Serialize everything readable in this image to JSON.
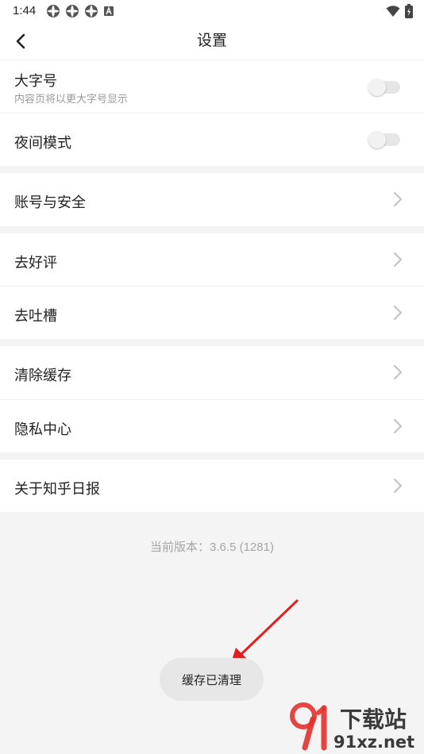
{
  "status_bar": {
    "time": "1:44",
    "left_icons": [
      "app-notification-icon",
      "app-notification-icon",
      "app-notification-icon",
      "font-a-icon"
    ],
    "right_icons": [
      "wifi-icon",
      "battery-icon"
    ]
  },
  "header": {
    "title": "设置",
    "back_icon": "back-arrow-icon"
  },
  "settings": {
    "large_font": {
      "label": "大字号",
      "subtitle": "内容页将以更大字号显示",
      "enabled": false
    },
    "night_mode": {
      "label": "夜间模式",
      "enabled": false
    },
    "account": {
      "label": "账号与安全"
    },
    "rate": {
      "label": "去好评"
    },
    "feedback": {
      "label": "去吐槽"
    },
    "clear_cache": {
      "label": "清除缓存"
    },
    "privacy": {
      "label": "隐私中心"
    },
    "about": {
      "label": "关于知乎日报"
    }
  },
  "version_text": "当前版本：3.6.5 (1281)",
  "toast": {
    "text": "缓存已清理"
  },
  "overlay": {
    "arrow_color": "#e02020"
  },
  "watermark": {
    "brand": "下载站",
    "domain": "91xz.net",
    "colors": {
      "red": "#e5322d",
      "dark": "#3a3a3a"
    }
  }
}
